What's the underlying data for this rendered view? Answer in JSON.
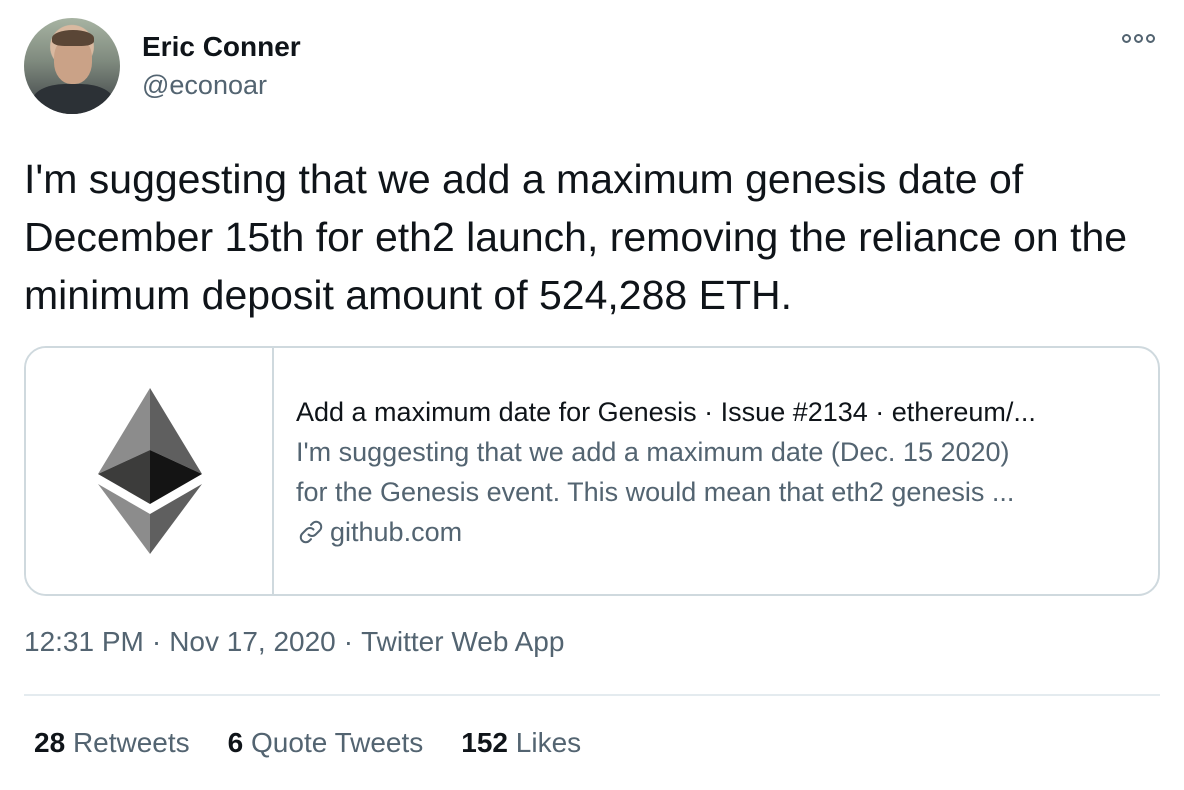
{
  "author": {
    "name": "Eric Conner",
    "handle": "@econoar"
  },
  "tweet": {
    "text": "I'm suggesting that we add a maximum genesis date of December 15th for eth2 launch, removing the reliance on the minimum deposit amount of 524,288 ETH."
  },
  "card": {
    "media_icon": "ethereum-logo-icon",
    "title": "Add a maximum date for Genesis · Issue #2134 · ethereum/...",
    "description_line1": "I'm suggesting that we add a maximum date (Dec. 15 2020)",
    "description_line2": "for the Genesis event. This would mean that eth2 genesis ...",
    "link_icon": "link-icon",
    "domain": "github.com"
  },
  "meta": {
    "time": "12:31 PM",
    "date": "Nov 17, 2020",
    "source": "Twitter Web App",
    "separator": "·"
  },
  "stats": {
    "retweets_count": "28",
    "retweets_label": "Retweets",
    "quotes_count": "6",
    "quotes_label": "Quote Tweets",
    "likes_count": "152",
    "likes_label": "Likes"
  },
  "colors": {
    "text_primary": "#0f1419",
    "text_secondary": "#536471",
    "border": "#cfd9de"
  }
}
